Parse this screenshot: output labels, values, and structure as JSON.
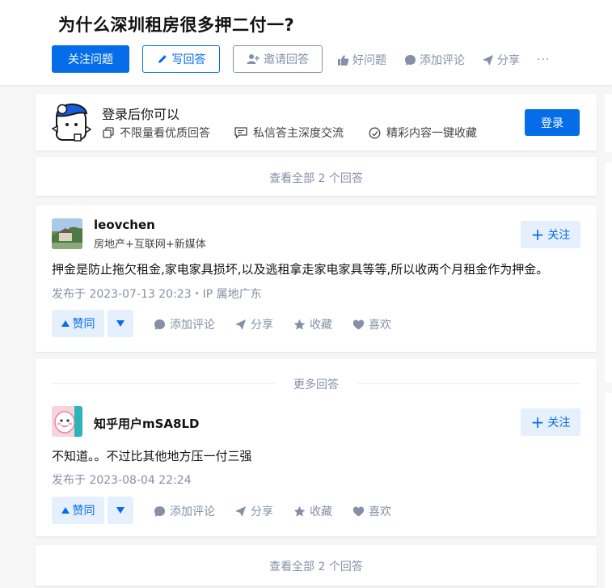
{
  "question": {
    "title": "为什么深圳租房很多押二付一?",
    "actions": {
      "follow": "关注问题",
      "write": "写回答",
      "invite": "邀请回答",
      "good_question": "好问题",
      "add_comment": "添加评论",
      "share": "分享",
      "more": "···"
    }
  },
  "login_banner": {
    "title": "登录后你可以",
    "perks": [
      "不限量看优质回答",
      "私信答主深度交流",
      "精彩内容一键收藏"
    ],
    "button": "登录"
  },
  "view_all": "查看全部 2 个回答",
  "more_answers": "更多回答",
  "answers": [
    {
      "author": "leovchen",
      "bio": "房地产+互联网+新媒体",
      "follow": "关注",
      "content": "押金是防止拖欠租金,家电家具损坏,以及逃租拿走家电家具等等,所以收两个月租金作为押金。",
      "meta": "发布于 2023-07-13 20:23・IP 属地广东",
      "vote": "赞同",
      "comment": "添加评论",
      "share": "分享",
      "collect": "收藏",
      "like": "喜欢"
    },
    {
      "author": "知乎用户mSA8LD",
      "bio": "",
      "follow": "关注",
      "content": "不知道。。不过比其他地方压一付三强",
      "meta": "发布于 2023-08-04 22:24",
      "vote": "赞同",
      "comment": "添加评论",
      "share": "分享",
      "collect": "收藏",
      "like": "喜欢"
    }
  ],
  "colors": {
    "accent": "#056de8",
    "muted": "#8590a6",
    "background": "#f6f6f6"
  },
  "icons": [
    "pencil-icon",
    "invite-user-icon",
    "thumbs-up-icon",
    "comment-icon",
    "share-icon",
    "copy-icon",
    "message-icon",
    "collect-icon",
    "plus-icon",
    "caret-up-icon",
    "caret-down-icon",
    "star-icon",
    "heart-icon",
    "mascot-icon"
  ]
}
